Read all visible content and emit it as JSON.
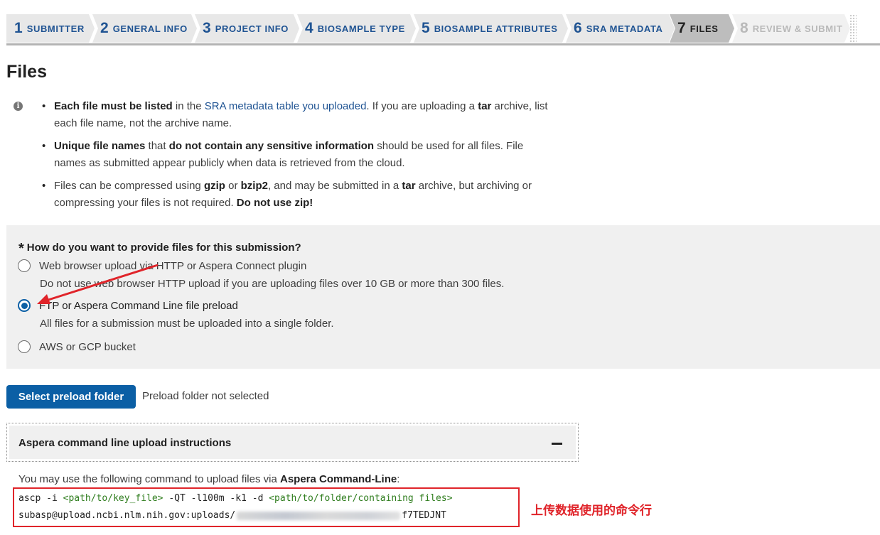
{
  "steps": [
    {
      "num": "1",
      "label": "Submitter",
      "state": "done"
    },
    {
      "num": "2",
      "label": "General Info",
      "state": "done"
    },
    {
      "num": "3",
      "label": "Project Info",
      "state": "done"
    },
    {
      "num": "4",
      "label": "Biosample Type",
      "state": "done"
    },
    {
      "num": "5",
      "label": "Biosample Attributes",
      "state": "done"
    },
    {
      "num": "6",
      "label": "SRA Metadata",
      "state": "done"
    },
    {
      "num": "7",
      "label": "Files",
      "state": "active"
    },
    {
      "num": "8",
      "label": "Review & Submit",
      "state": "disabled"
    }
  ],
  "page": {
    "title": "Files"
  },
  "info": {
    "b1": {
      "bold": "Each file must be listed",
      "pre": " in the ",
      "link": "SRA metadata table you uploaded",
      "mid": ". If you are uploading a ",
      "bold2": "tar",
      "post": " archive, list each file name, not the archive name."
    },
    "b2": {
      "bold": "Unique file names",
      "pre": " that ",
      "bold2": "do not contain any sensitive information",
      "post": " should be used for all files. File names as submitted appear publicly when data is retrieved from the cloud."
    },
    "b3": {
      "pre": "Files can be compressed using ",
      "bold": "gzip",
      "mid": " or ",
      "bold2": "bzip2",
      "mid2": ", and may be submitted in a ",
      "bold3": "tar",
      "mid3": " archive, but archiving or compressing your files is not required. ",
      "bold4": "Do not use zip!"
    }
  },
  "question": {
    "required_mark": "*",
    "label": "How do you want to provide files for this submission?",
    "options": [
      {
        "label": "Web browser upload via HTTP or Aspera Connect plugin",
        "hint": "Do not use web browser HTTP upload if you are uploading files over 10 GB or more than 300 files.",
        "checked": false
      },
      {
        "label": "FTP or Aspera Command Line file preload",
        "hint": "All files for a submission must be uploaded into a single folder.",
        "checked": true
      },
      {
        "label": "AWS or GCP bucket",
        "hint": "",
        "checked": false
      }
    ]
  },
  "preload": {
    "button": "Select preload folder",
    "status": "Preload folder not selected"
  },
  "aspera": {
    "title": "Aspera command line upload instructions",
    "toggle_icon": "minus-icon",
    "note_pre": "You may use the following command to upload files via ",
    "note_bold": "Aspera Command-Line",
    "note_post": ":",
    "cmd_l1_a": "ascp -i ",
    "cmd_l1_key": "<path/to/key_file>",
    "cmd_l1_b": " -QT -l100m -k1 -d ",
    "cmd_l1_folder": "<path/to/folder/containing files>",
    "cmd_l2_a": "subasp@upload.ncbi.nlm.nih.gov:uploads/",
    "cmd_l2_b": "f7TEDJNT"
  },
  "annotation": {
    "text": "上传数据使用的命令行"
  },
  "colors": {
    "accent": "#0b5fa5",
    "link": "#205493",
    "annotation_red": "#e0242a",
    "panel_bg": "#f0f0f0",
    "placeholder_green": "#2f7d1e"
  }
}
